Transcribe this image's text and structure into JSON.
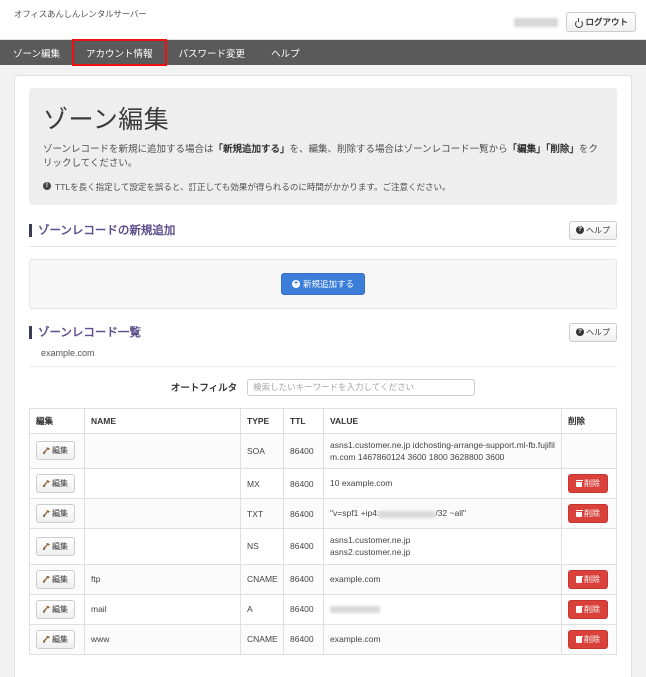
{
  "header": {
    "brand": "オフィスあんしんレンタルサーバー",
    "logout_label": "ログアウト",
    "user_redacted": true
  },
  "nav": {
    "items": [
      {
        "label": "ゾーン編集",
        "active": false,
        "annotated": false
      },
      {
        "label": "アカウント情報",
        "active": false,
        "annotated": true
      },
      {
        "label": "パスワード変更",
        "active": false,
        "annotated": false
      },
      {
        "label": "ヘルプ",
        "active": false,
        "annotated": false
      }
    ],
    "annotation_color": "#ee1111"
  },
  "jumbotron": {
    "title": "ゾーン編集",
    "description_1": "ゾーンレコードを新規に追加する場合は",
    "description_strong_1": "「新規追加する」",
    "description_2": "を、編集、削除する場合はゾーンレコード一覧から",
    "description_strong_2": "「編集」",
    "description_strong_3": "「削除」",
    "description_3": "をクリックしてください。",
    "note": "TTLを長く指定して設定を誤ると、訂正しても効果が得られるのに時間がかかります。ご注意ください。",
    "note_icon": "exclamation-circle-icon"
  },
  "add_section": {
    "title": "ゾーンレコードの新規追加",
    "help_label": "ヘルプ",
    "add_label": "新規追加する",
    "add_icon": "plus-circle-icon",
    "button_color": "#3c7dd9"
  },
  "list_section": {
    "title": "ゾーンレコード一覧",
    "help_label": "ヘルプ",
    "zone_name": "example.com",
    "filter_label": "オートフィルタ",
    "filter_placeholder": "検索したいキーワードを入力してください",
    "filter_value": ""
  },
  "table": {
    "headers": [
      "編集",
      "NAME",
      "TYPE",
      "TTL",
      "VALUE",
      "削除"
    ],
    "edit_label": "編集",
    "delete_label": "削除",
    "edit_icon": "wrench-icon",
    "delete_icon": "trash-icon",
    "delete_color": "#d9413a",
    "rows": [
      {
        "name": "",
        "type": "SOA",
        "ttl": "86400",
        "value": "asns1.customer.ne.jp idchosting-arrange-support.ml-fb.fujifilm.com 1467860124 3600 1800 3628800 3600",
        "value_redacted": false,
        "has_edit": true,
        "has_delete": false
      },
      {
        "name": "",
        "type": "MX",
        "ttl": "86400",
        "value": "10 example.com",
        "value_redacted": false,
        "has_edit": true,
        "has_delete": true
      },
      {
        "name": "",
        "type": "TXT",
        "ttl": "86400",
        "value_prefix": "\"v=spf1 +ip4:",
        "value_suffix": "/32 ~all\"",
        "value_redacted": true,
        "has_edit": true,
        "has_delete": true
      },
      {
        "name": "",
        "type": "NS",
        "ttl": "86400",
        "value": "asns1.customer.ne.jp\nasns2.customer.ne.jp",
        "value_redacted": false,
        "has_edit": true,
        "has_delete": false
      },
      {
        "name": "ftp",
        "type": "CNAME",
        "ttl": "86400",
        "value": "example.com",
        "value_redacted": false,
        "has_edit": true,
        "has_delete": true
      },
      {
        "name": "mail",
        "type": "A",
        "ttl": "86400",
        "value_prefix": "",
        "value_suffix": "",
        "value_redacted": true,
        "has_edit": true,
        "has_delete": true
      },
      {
        "name": "www",
        "type": "CNAME",
        "ttl": "86400",
        "value": "example.com",
        "value_redacted": false,
        "has_edit": true,
        "has_delete": true
      }
    ]
  }
}
